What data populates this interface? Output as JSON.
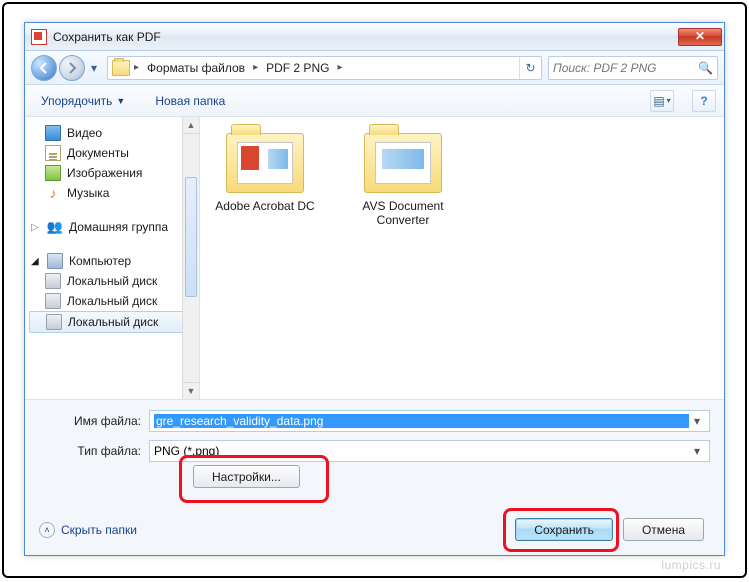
{
  "window": {
    "title": "Сохранить как PDF"
  },
  "nav": {
    "path": [
      "Форматы файлов",
      "PDF 2 PNG"
    ],
    "search_placeholder": "Поиск: PDF 2 PNG"
  },
  "toolbar": {
    "organize": "Упорядочить",
    "new_folder": "Новая папка"
  },
  "sidebar": {
    "items": [
      {
        "label": "Видео",
        "icon": "video-icon"
      },
      {
        "label": "Документы",
        "icon": "document-icon"
      },
      {
        "label": "Изображения",
        "icon": "pictures-icon"
      },
      {
        "label": "Музыка",
        "icon": "music-icon"
      }
    ],
    "homegroup": "Домашняя группа",
    "computer": "Компьютер",
    "drives": [
      {
        "label": "Локальный диск"
      },
      {
        "label": "Локальный диск"
      },
      {
        "label": "Локальный диск"
      }
    ]
  },
  "content": {
    "folders": [
      {
        "name": "Adobe Acrobat DC"
      },
      {
        "name": "AVS Document Converter"
      }
    ]
  },
  "form": {
    "filename_label": "Имя файла:",
    "filename_value": "gre_research_validity_data.png",
    "filetype_label": "Тип файла:",
    "filetype_value": "PNG (*.png)",
    "settings": "Настройки...",
    "hide_folders": "Скрыть папки",
    "save": "Сохранить",
    "cancel": "Отмена"
  },
  "watermark": "lumpics.ru"
}
